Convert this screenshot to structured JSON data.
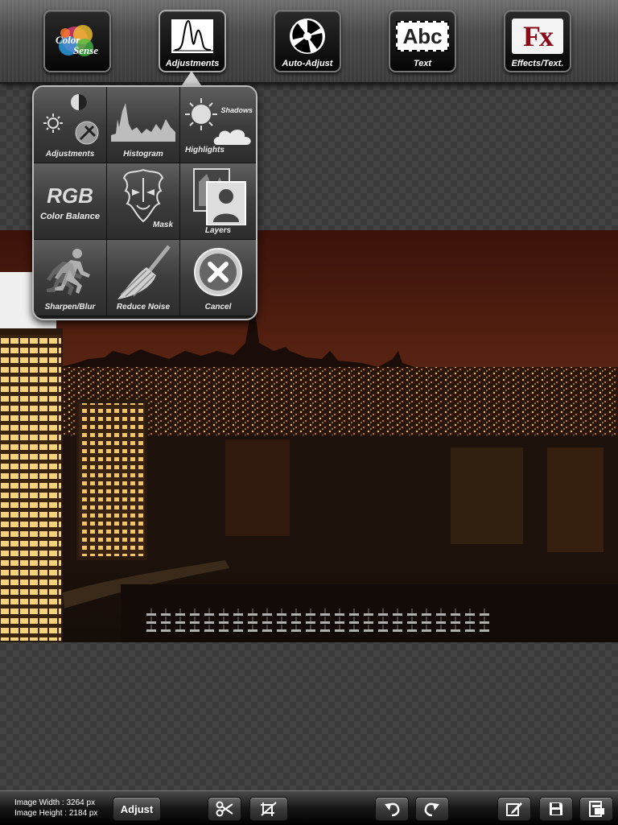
{
  "toolbar": {
    "items": [
      {
        "label": "",
        "icon": "color-sense-logo-icon",
        "logo_text": "Color Sense"
      },
      {
        "label": "Adjustments",
        "icon": "waveform-icon"
      },
      {
        "label": "Auto-Adjust",
        "icon": "aperture-icon"
      },
      {
        "label": "Text",
        "icon": "text-abc-icon",
        "glyph": "Abc"
      },
      {
        "label": "Effects/Text.",
        "icon": "fx-icon",
        "glyph": "Fx"
      }
    ]
  },
  "popup": {
    "items": [
      {
        "label": "Adjustments",
        "icon": "brightness-contrast-icon"
      },
      {
        "label": "Histogram",
        "icon": "histogram-icon"
      },
      {
        "label": "Highlights",
        "icon": "sun-cloud-icon",
        "extra": "Shadows"
      },
      {
        "label": "Color Balance",
        "icon": "rgb-icon",
        "glyph": "RGB"
      },
      {
        "label": "Mask",
        "icon": "tribal-mask-icon"
      },
      {
        "label": "Layers",
        "icon": "layers-icon"
      },
      {
        "label": "Sharpen/Blur",
        "icon": "running-person-icon"
      },
      {
        "label": "Reduce Noise",
        "icon": "broom-icon"
      },
      {
        "label": "Cancel",
        "icon": "cancel-x-icon"
      }
    ]
  },
  "status": {
    "width_label": "Image Width",
    "width_value": ": 3264 px",
    "height_label": "Image Height",
    "height_value": ": 2184 px"
  },
  "bottom": {
    "adjust_label": "Adjust",
    "icons": [
      "scissors-icon",
      "no-crop-icon",
      "undo-icon",
      "redo-icon",
      "edit-icon",
      "save-icon",
      "export-icon"
    ]
  }
}
